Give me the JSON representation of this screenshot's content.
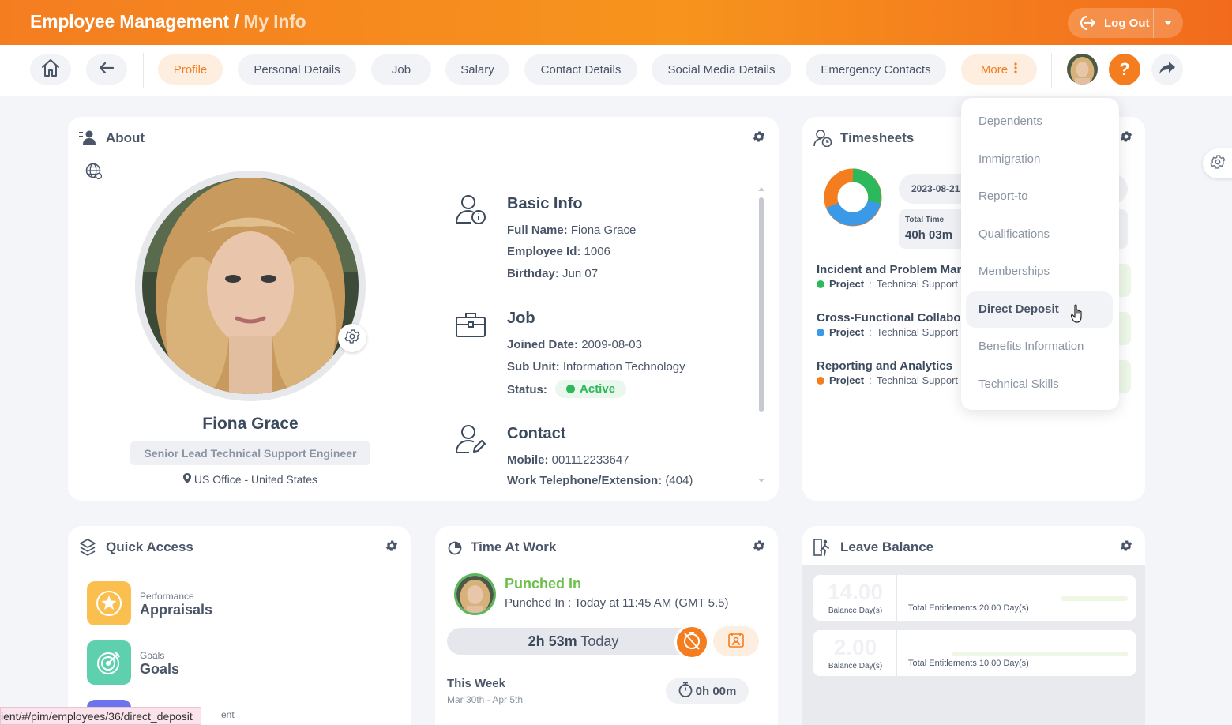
{
  "header": {
    "title": "Employee Management /",
    "subtitle": "My Info",
    "logout_label": "Log Out"
  },
  "tabs": {
    "items": [
      "Profile",
      "Personal Details",
      "Job",
      "Salary",
      "Contact Details",
      "Social Media Details",
      "Emergency Contacts"
    ],
    "more_label": "More",
    "active": "Profile",
    "help_label": "?"
  },
  "about": {
    "title": "About",
    "name": "Fiona Grace",
    "role": "Senior Lead Technical Support Engineer",
    "location": "US Office - United States",
    "basic_info": {
      "heading": "Basic Info",
      "full_name_label": "Full Name:",
      "full_name": "Fiona Grace",
      "employee_id_label": "Employee Id:",
      "employee_id": "1006",
      "birthday_label": "Birthday:",
      "birthday": "Jun 07"
    },
    "job": {
      "heading": "Job",
      "joined_label": "Joined Date:",
      "joined": "2009-08-03",
      "sub_unit_label": "Sub Unit:",
      "sub_unit": "Information Technology",
      "status_label": "Status:",
      "status": "Active"
    },
    "contact": {
      "heading": "Contact",
      "mobile_label": "Mobile:",
      "mobile": "001112233647",
      "work_tel_label": "Work Telephone/Extension:",
      "work_tel": "(404)"
    }
  },
  "timesheets": {
    "title": "Timesheets",
    "date": "2023-08-21",
    "total_time_label": "Total Time",
    "total_time": "40h 03m",
    "items": [
      {
        "title": "Incident and Problem Mar",
        "project_label": "Project",
        "project": "Technical Support",
        "color": "#2eb85c"
      },
      {
        "title": "Cross-Functional Collabo",
        "project_label": "Project",
        "project": "Technical Support",
        "color": "#3b9ae8"
      },
      {
        "title": "Reporting and Analytics",
        "project_label": "Project",
        "project": "Technical Support",
        "color": "#f47d20"
      }
    ]
  },
  "more_menu": {
    "items": [
      "Dependents",
      "Immigration",
      "Report-to",
      "Qualifications",
      "Memberships",
      "Direct Deposit",
      "Benefits Information",
      "Technical Skills"
    ],
    "hovered": "Direct Deposit"
  },
  "quick_access": {
    "title": "Quick Access",
    "items": [
      {
        "category": "Performance",
        "label": "Appraisals"
      },
      {
        "category": "Goals",
        "label": "Goals"
      }
    ],
    "partial_label": "ent"
  },
  "time_at_work": {
    "title": "Time At Work",
    "status": "Punched In",
    "detail": "Punched In : Today at 11:45 AM (GMT 5.5)",
    "today_hours": "2h 53m",
    "today_label": "Today",
    "week_title": "This Week",
    "week_range": "Mar 30th - Apr 5th",
    "week_hours": "0h 00m"
  },
  "leave_balance": {
    "title": "Leave Balance",
    "rows": [
      {
        "balance": "14.00",
        "balance_label": "Balance Day(s)",
        "total": "Total Entitlements 20.00 Day(s)"
      },
      {
        "balance": "2.00",
        "balance_label": "Balance Day(s)",
        "total": "Total Entitlements 10.00 Day(s)"
      }
    ]
  },
  "status_bar": {
    "url": "ient/#/pim/employees/36/direct_deposit"
  },
  "colors": {
    "accent": "#f47d20",
    "active_green": "#2eb85c"
  }
}
